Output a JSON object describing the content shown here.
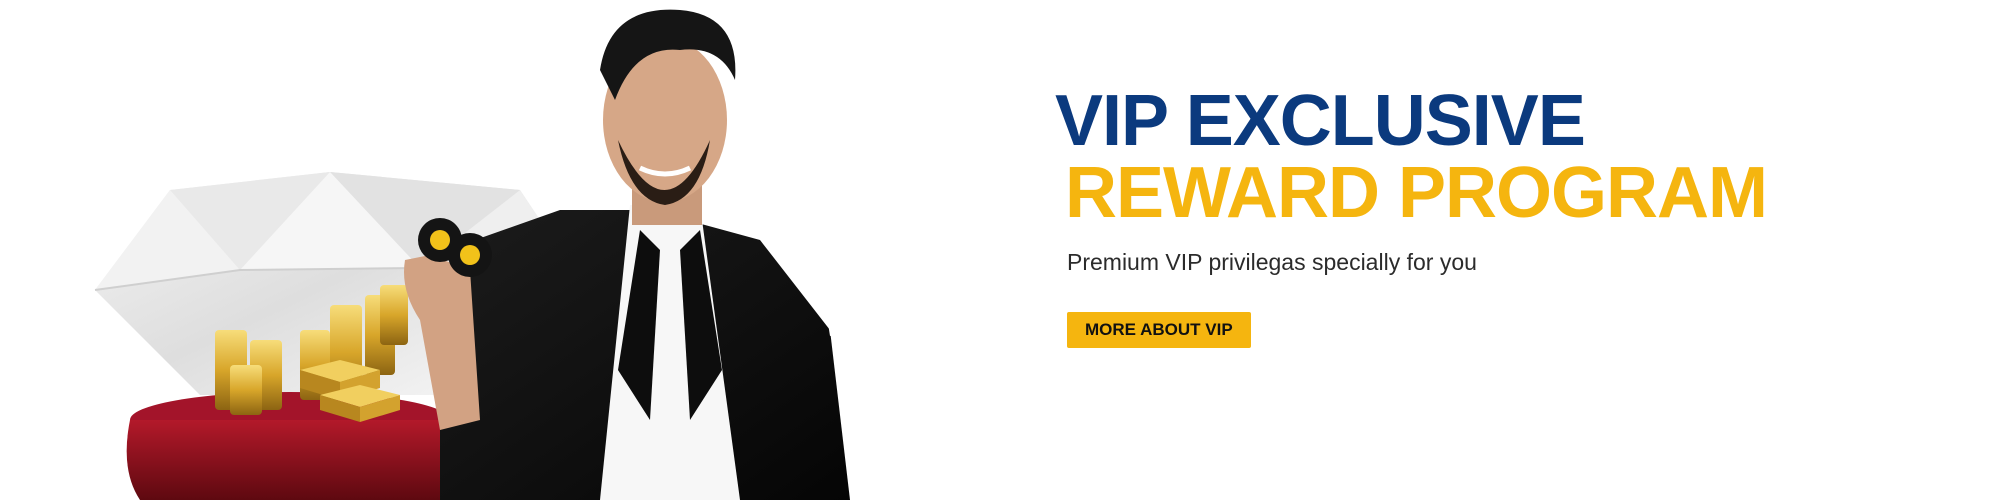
{
  "hero": {
    "headline_line1": "VIP EXCLUSIVE",
    "headline_line2": "REWARD PROGRAM",
    "subtitle": "Premium VIP privilegas specially for you",
    "cta_label": "MORE ABOUT VIP"
  },
  "colors": {
    "headline_primary": "#0b3a7e",
    "headline_accent": "#f5b50f",
    "cta_background": "#f5b50f",
    "cta_text": "#111111",
    "background": "#ffffff"
  },
  "imagery": {
    "left_art": [
      "diamond-illustration",
      "gold-coins-stack",
      "gold-bars",
      "red-table",
      "man-in-tuxedo",
      "poker-chips"
    ]
  }
}
